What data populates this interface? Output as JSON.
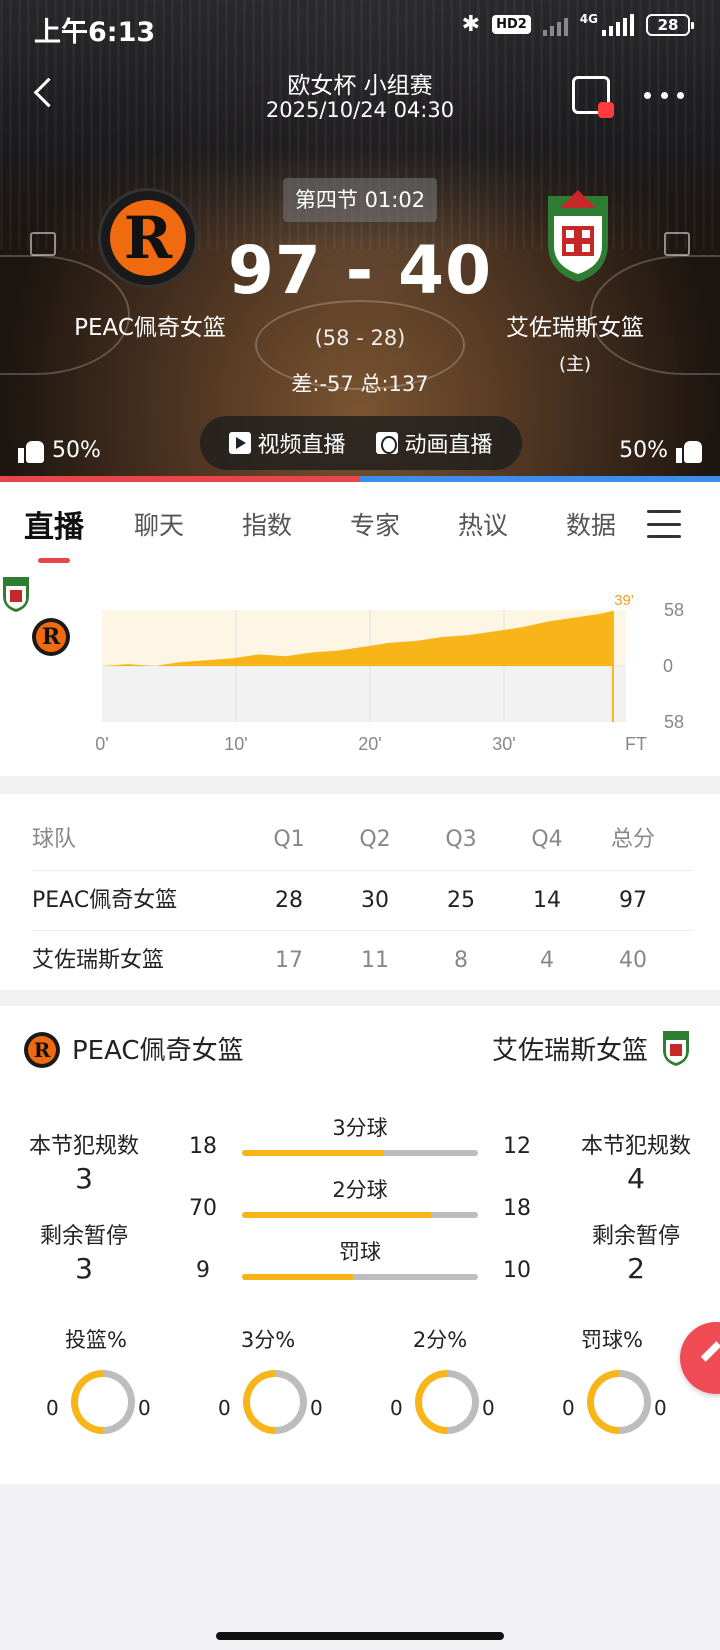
{
  "status_bar": {
    "time": "上午6:13",
    "hd": "HD2",
    "net": "4G",
    "battery": "28"
  },
  "header": {
    "title": "欧女杯 小组赛",
    "datetime": "2025/10/24 04:30",
    "period": "第四节 01:02",
    "score": "97 - 40",
    "half_score": "(58 - 28)",
    "diff_total": "差:-57 总:137",
    "home": {
      "name": "PEAC佩奇女篮",
      "logo_letter": "R",
      "support": "50%"
    },
    "away": {
      "name": "艾佐瑞斯女篮",
      "tag": "(主)",
      "support": "50%"
    },
    "live_video": "视频直播",
    "live_anim": "动画直播",
    "colors": {
      "home": "#e8464a",
      "away": "#3d8ee8"
    }
  },
  "tabs": [
    "直播",
    "聊天",
    "指数",
    "专家",
    "热议",
    "数据"
  ],
  "trend": {
    "current_minute_label": "39'",
    "y_top": "58",
    "y_mid": "0",
    "y_bottom": "58",
    "x_ticks": [
      "0'",
      "10'",
      "20'",
      "30'",
      "FT"
    ],
    "lead_points": [
      [
        0,
        0
      ],
      [
        2,
        2
      ],
      [
        4,
        0
      ],
      [
        6,
        4
      ],
      [
        8,
        6
      ],
      [
        10,
        8
      ],
      [
        12,
        12
      ],
      [
        14,
        10
      ],
      [
        16,
        14
      ],
      [
        18,
        16
      ],
      [
        20,
        20
      ],
      [
        22,
        24
      ],
      [
        24,
        26
      ],
      [
        26,
        30
      ],
      [
        28,
        32
      ],
      [
        30,
        36
      ],
      [
        32,
        40
      ],
      [
        34,
        46
      ],
      [
        36,
        50
      ],
      [
        38,
        54
      ],
      [
        39,
        57
      ]
    ]
  },
  "quarter_table": {
    "headers": [
      "球队",
      "Q1",
      "Q2",
      "Q3",
      "Q4",
      "总分"
    ],
    "rows": [
      [
        "PEAC佩奇女篮",
        "28",
        "30",
        "25",
        "14",
        "97"
      ],
      [
        "艾佐瑞斯女篮",
        "17",
        "11",
        "8",
        "4",
        "40"
      ]
    ]
  },
  "stats": {
    "home_name": "PEAC佩奇女篮",
    "away_name": "艾佐瑞斯女篮",
    "fouls_label": "本节犯规数",
    "home_fouls": "3",
    "away_fouls": "4",
    "timeouts_label": "剩余暂停",
    "home_timeouts": "3",
    "away_timeouts": "2",
    "bars": [
      {
        "label": "3分球",
        "home": "18",
        "away": "12",
        "home_ratio": 0.6
      },
      {
        "label": "2分球",
        "home": "70",
        "away": "18",
        "home_ratio": 0.8
      },
      {
        "label": "罚球",
        "home": "9",
        "away": "10",
        "home_ratio": 0.47
      }
    ],
    "pct": [
      {
        "label": "投篮%",
        "home": "0",
        "away": "0"
      },
      {
        "label": "3分%",
        "home": "0",
        "away": "0"
      },
      {
        "label": "2分%",
        "home": "0",
        "away": "0"
      },
      {
        "label": "罚球%",
        "home": "0",
        "away": "0"
      }
    ],
    "accent": "#f7b51a"
  }
}
